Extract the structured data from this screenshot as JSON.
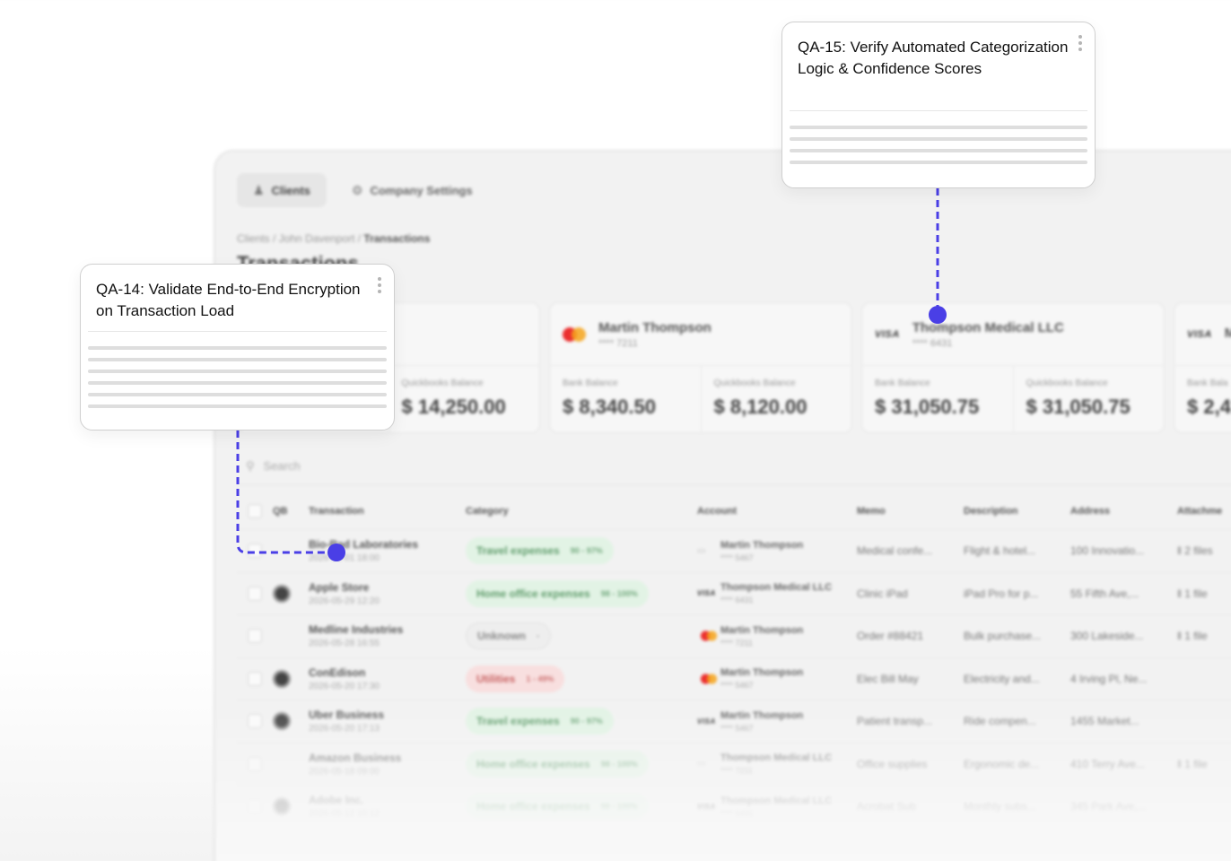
{
  "topbar": {
    "tabs": [
      {
        "label": "Clients",
        "active": true
      },
      {
        "label": "Company Settings",
        "active": false
      }
    ]
  },
  "breadcrumb": {
    "path": "Clients / John Davenport / ",
    "current": "Transactions"
  },
  "page_title": "Transactions",
  "cards": [
    {
      "name": "",
      "mask": "",
      "brand": "none",
      "bank_label": "",
      "bank_value": "",
      "qb_label": "Quickbooks Balance",
      "qb_value": "$ 14,250.00"
    },
    {
      "name": "Martin Thompson",
      "mask": "**** 7211",
      "brand": "mastercard",
      "bank_label": "Bank Balance",
      "bank_value": "$ 8,340.50",
      "qb_label": "Quickbooks Balance",
      "qb_value": "$ 8,120.00"
    },
    {
      "name": "Thompson Medical LLC",
      "mask": "**** 6431",
      "brand": "visa",
      "bank_label": "Bank Balance",
      "bank_value": "$ 31,050.75",
      "qb_label": "Quickbooks Balance",
      "qb_value": "$ 31,050.75"
    },
    {
      "name": "M",
      "mask": "",
      "brand": "visa",
      "bank_label": "Bank Bala",
      "bank_value": "$ 2,41",
      "qb_label": "",
      "qb_value": ""
    }
  ],
  "search": {
    "placeholder": "Search"
  },
  "table": {
    "headers": {
      "qb": "QB",
      "transaction": "Transaction",
      "category": "Category",
      "account": "Account",
      "memo": "Memo",
      "description": "Description",
      "address": "Address",
      "attachments": "Attachme"
    },
    "rows": [
      {
        "name": "Bio-Rad Laboratories",
        "date": "2026-06-01 18:00",
        "qb": false,
        "category": "Travel expenses",
        "conf": "90 - 97%",
        "cat_color": "green",
        "acct_icon": "card",
        "acct_name": "Martin Thompson",
        "acct_mask": "**** 5467",
        "memo": "Medical confe...",
        "desc": "Flight & hotel...",
        "addr": "100 Innovatio...",
        "att": "2 files"
      },
      {
        "name": "Apple Store",
        "date": "2026-05-29 12:20",
        "qb": true,
        "category": "Home office expenses",
        "conf": "98 - 100%",
        "cat_color": "green",
        "acct_icon": "visa",
        "acct_name": "Thompson Medical LLC",
        "acct_mask": "**** 6431",
        "memo": "Clinic iPad",
        "desc": "iPad Pro for p...",
        "addr": "55 Fifth Ave,...",
        "att": "1 file"
      },
      {
        "name": "Medline Industries",
        "date": "2026-05-28 16:55",
        "qb": false,
        "category": "Unknown",
        "conf": "-",
        "cat_color": "grey",
        "acct_icon": "mastercard",
        "acct_name": "Martin Thompson",
        "acct_mask": "**** 7211",
        "memo": "Order #88421",
        "desc": "Bulk purchase...",
        "addr": "300 Lakeside...",
        "att": "1 file"
      },
      {
        "name": "ConEdison",
        "date": "2026-05-20 17:30",
        "qb": true,
        "category": "Utilities",
        "conf": "1 - 49%",
        "cat_color": "red",
        "acct_icon": "mastercard",
        "acct_name": "Martin Thompson",
        "acct_mask": "**** 5467",
        "memo": "Elec Bill May",
        "desc": "Electricity and...",
        "addr": "4 Irving Pl, Ne...",
        "att": ""
      },
      {
        "name": "Uber Business",
        "date": "2026-05-20 17:13",
        "qb": true,
        "category": "Travel expenses",
        "conf": "90 - 97%",
        "cat_color": "green",
        "acct_icon": "visa",
        "acct_name": "Martin Thompson",
        "acct_mask": "**** 5467",
        "memo": "Patient transp...",
        "desc": "Ride compen...",
        "addr": "1455 Market...",
        "att": ""
      },
      {
        "name": "Amazon Business",
        "date": "2026-05-18 09:00",
        "qb": false,
        "category": "Home office expenses",
        "conf": "98 - 100%",
        "cat_color": "green",
        "acct_icon": "card",
        "acct_name": "Thompson Medical LLC",
        "acct_mask": "**** 7211",
        "memo": "Office supplies",
        "desc": "Ergonomic de...",
        "addr": "410 Terry Ave...",
        "att": "1 file"
      },
      {
        "name": "Adobe Inc.",
        "date": "2026-05-12 10:12",
        "qb": true,
        "category": "Home office expenses",
        "conf": "98 - 100%",
        "cat_color": "green",
        "acct_icon": "visa",
        "acct_name": "Thompson Medical LLC",
        "acct_mask": "**** 6431",
        "memo": "Acrobat Sub",
        "desc": "Monthly subs...",
        "addr": "345 Park Ave,...",
        "att": ""
      }
    ]
  },
  "qa_cards": [
    {
      "title": "QA-15: Verify Automated Categorization Logic & Confidence Scores"
    },
    {
      "title": "QA-14: Validate End-to-End Encryption on Transaction Load"
    }
  ],
  "colors": {
    "connector": "#4a3fe6",
    "accent_green": "#5f9c6b",
    "accent_red": "#c86262"
  }
}
